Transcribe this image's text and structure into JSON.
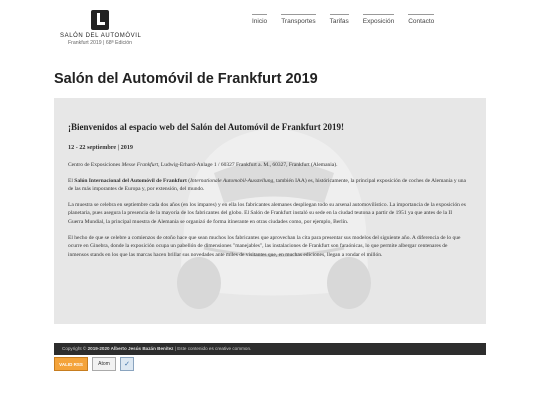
{
  "site": {
    "name": "SALÓN DEL AUTOMÓVIL",
    "subtitle": "Frankfurt 2019 | 68ª Edición",
    "logo_icon": "logo-l-icon"
  },
  "nav": [
    {
      "label": "Inicio"
    },
    {
      "label": "Transportes"
    },
    {
      "label": "Tarifas"
    },
    {
      "label": "Exposición"
    },
    {
      "label": "Contacto"
    }
  ],
  "page_title": "Salón del Automóvil de Frankfurt 2019",
  "content": {
    "heading": "¡Bienvenidos al espacio web del Salón del Automóvil de Frankfurt 2019!",
    "dates": "12 - 22 septiembre | 2019",
    "address_prefix": "Centro de Exposiciones ",
    "address_venue": "Messe Frankfurt",
    "address_suffix": ", Ludwig-Erhard-Anlage 1 / 60327 Frankfurt a. M., 60327, Frankfurt (Alemania).",
    "p1_prefix": "El ",
    "p1_bold": "Salón Internacional del Automóvil de Frankfurt",
    "p1_mid": " (",
    "p1_italic": "Internationale Automobil-Ausstellung",
    "p1_suffix": ", también IAA) es, históricamente, la principal exposición de coches de Alemania y una de las más imporantes de Europa y, por extensión, del mundo.",
    "p2": "La muestra se celebra en septiembre cada dos años (en los impares) y en ella los fabricantes alemanes despliegan todo su arsenal automovilístico. La importancia de la exposición es planetaria, pues asegura la presencia de la mayoría de los fabricantes del globo. El Salón de Frankfurt instaló su sede en la ciudad teutona a partir de 1951 ya que antes de la II Guerra Mundial, la principal muestra de Alemania se organizó de forma itinerante en otras ciudades como, por ejemplo, Berlín.",
    "p3": "El hecho de que se celebre a comienzos de otoño hace que sean muchos los fabricantes que aprovechan la cita para presentar sus modelos del siguiente año. A diferencia de lo que ocurre en Ginebra, donde la exposición ocupa un pabellón de dimensiones \"manejables\", las instalaciones de Frankfurt son faraónicas, lo que permite albergar centenares de inmensos stands en los que las marcas hacen brillar sus novedades ante miles de visitantes que, en muchas ediciones, llegan a rondar el millón."
  },
  "footer": {
    "prefix": "Copyright © ",
    "bold": "2019-2020 Alberto Jesús Bazán Benítez",
    "suffix": " | Este contenido es creative common."
  },
  "badges": {
    "rss": "VALID RSS",
    "atom": "Atom",
    "w3c": "✓"
  }
}
